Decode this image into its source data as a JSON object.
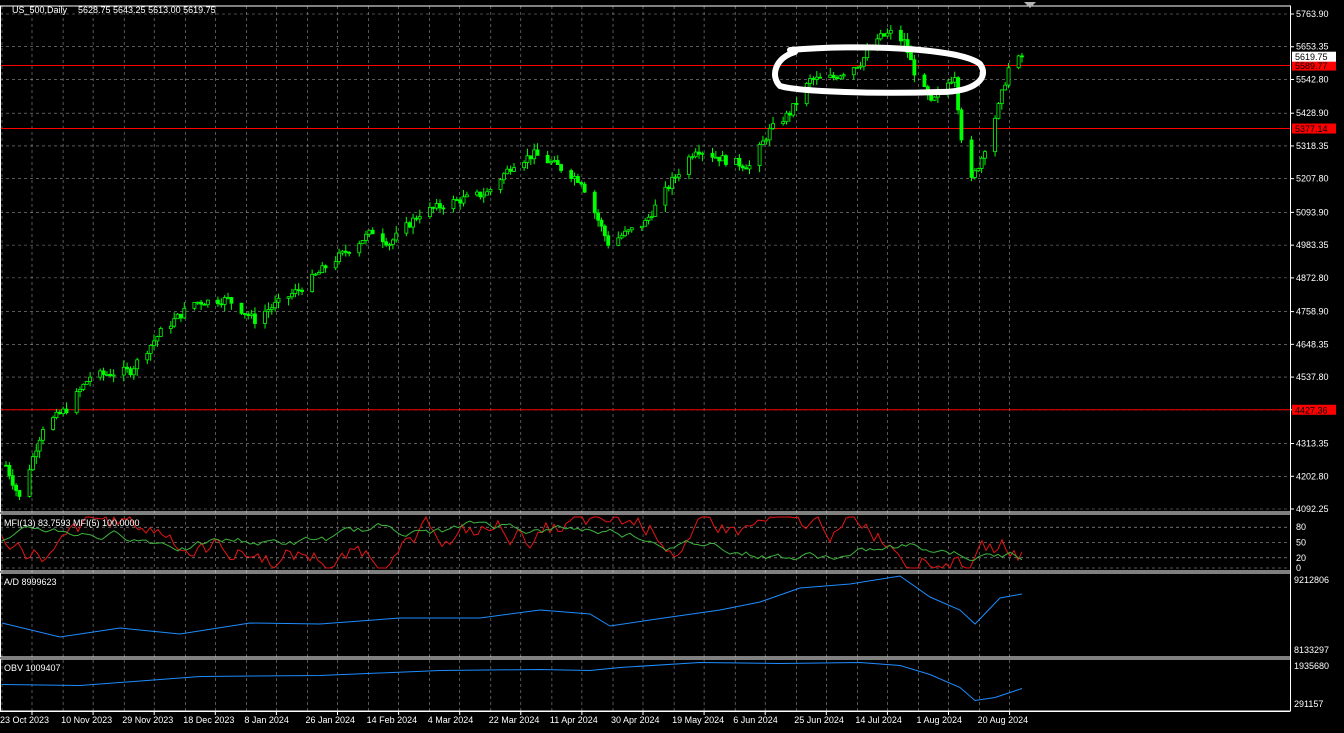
{
  "header": {
    "symbol": "US_500,Daily",
    "ohlc": "5628.75 5643.25 5613.00 5619.75"
  },
  "colors": {
    "background": "#000000",
    "grid": "#b4b4b4",
    "candle": "#00ff00",
    "hline": "#ff0000",
    "mfi13": "#3cb43c",
    "mfi5": "#e61414",
    "ad": "#1e8cff",
    "obv": "#1e8cff",
    "highlight": "#ffffff"
  },
  "price_axis": {
    "ticks": [
      "5763.90",
      "5653.35",
      "5542.80",
      "5428.90",
      "5318.35",
      "5207.80",
      "5093.90",
      "4983.35",
      "4872.80",
      "4758.90",
      "4648.35",
      "4537.80",
      "4427.36",
      "4313.35",
      "4202.80",
      "4092.25"
    ],
    "current_price": "5619.75",
    "hlines": [
      {
        "value": 5589.77,
        "label": "5589.77"
      },
      {
        "value": 5377.14,
        "label": "5377.14"
      },
      {
        "value": 4427.36,
        "label": "4427.36"
      }
    ]
  },
  "date_axis": {
    "labels": [
      "23 Oct 2023",
      "10 Nov 2023",
      "29 Nov 2023",
      "18 Dec 2023",
      "8 Jan 2024",
      "26 Jan 2024",
      "14 Feb 2024",
      "4 Mar 2024",
      "22 Mar 2024",
      "11 Apr 2024",
      "30 Apr 2024",
      "19 May 2024",
      "6 Jun 2024",
      "25 Jun 2024",
      "14 Jul 2024",
      "1 Aug 2024",
      "20 Aug 2024"
    ]
  },
  "indicators": {
    "mfi": {
      "label": "MFI(13) 83.7593  MFI(5) 100.0000",
      "levels": [
        "80",
        "50",
        "20",
        "0"
      ]
    },
    "ad": {
      "label": "A/D 8999623",
      "top": "9212806",
      "bottom": "8133297"
    },
    "obv": {
      "label": "OBV 1009407",
      "top": "1935680",
      "bottom": "291157"
    }
  },
  "chart_data": {
    "type": "candlestick",
    "series": [
      {
        "name": "US_500,Daily",
        "values_close_approx": [
          {
            "x": "2023-10-23",
            "y": 4240
          },
          {
            "x": "2023-10-27",
            "y": 4130
          },
          {
            "x": "2023-11-03",
            "y": 4370
          },
          {
            "x": "2023-11-10",
            "y": 4430
          },
          {
            "x": "2023-11-17",
            "y": 4540
          },
          {
            "x": "2023-11-29",
            "y": 4560
          },
          {
            "x": "2023-12-08",
            "y": 4690
          },
          {
            "x": "2023-12-18",
            "y": 4790
          },
          {
            "x": "2023-12-28",
            "y": 4800
          },
          {
            "x": "2024-01-05",
            "y": 4730
          },
          {
            "x": "2024-01-08",
            "y": 4760
          },
          {
            "x": "2024-01-19",
            "y": 4840
          },
          {
            "x": "2024-01-26",
            "y": 4910
          },
          {
            "x": "2024-02-09",
            "y": 5030
          },
          {
            "x": "2024-02-14",
            "y": 4990
          },
          {
            "x": "2024-02-23",
            "y": 5090
          },
          {
            "x": "2024-03-04",
            "y": 5130
          },
          {
            "x": "2024-03-14",
            "y": 5160
          },
          {
            "x": "2024-03-22",
            "y": 5260
          },
          {
            "x": "2024-03-28",
            "y": 5290
          },
          {
            "x": "2024-04-04",
            "y": 5250
          },
          {
            "x": "2024-04-11",
            "y": 5200
          },
          {
            "x": "2024-04-19",
            "y": 4990
          },
          {
            "x": "2024-04-30",
            "y": 5060
          },
          {
            "x": "2024-05-08",
            "y": 5200
          },
          {
            "x": "2024-05-15",
            "y": 5310
          },
          {
            "x": "2024-05-24",
            "y": 5270
          },
          {
            "x": "2024-05-31",
            "y": 5250
          },
          {
            "x": "2024-06-06",
            "y": 5370
          },
          {
            "x": "2024-06-12",
            "y": 5430
          },
          {
            "x": "2024-06-18",
            "y": 5540
          },
          {
            "x": "2024-06-25",
            "y": 5550
          },
          {
            "x": "2024-07-03",
            "y": 5600
          },
          {
            "x": "2024-07-08",
            "y": 5680
          },
          {
            "x": "2024-07-12",
            "y": 5700
          },
          {
            "x": "2024-07-16",
            "y": 5670
          },
          {
            "x": "2024-07-19",
            "y": 5570
          },
          {
            "x": "2024-07-24",
            "y": 5460
          },
          {
            "x": "2024-07-31",
            "y": 5560
          },
          {
            "x": "2024-08-02",
            "y": 5350
          },
          {
            "x": "2024-08-05",
            "y": 5200
          },
          {
            "x": "2024-08-08",
            "y": 5280
          },
          {
            "x": "2024-08-13",
            "y": 5450
          },
          {
            "x": "2024-08-16",
            "y": 5580
          },
          {
            "x": "2024-08-20",
            "y": 5619.75
          }
        ]
      }
    ],
    "ylim": [
      4092.25,
      5763.9
    ],
    "grid": true,
    "annotation": "hand-drawn white ellipse around the June–July 2024 consolidation"
  }
}
